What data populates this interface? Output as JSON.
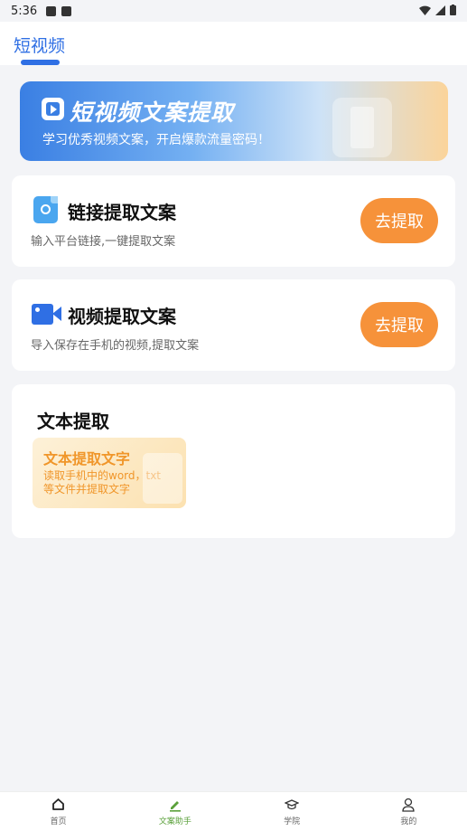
{
  "status_bar": {
    "time": "5:36"
  },
  "header": {
    "title": "短视频"
  },
  "banner": {
    "title": "短视频文案提取",
    "subtitle": "学习优秀视频文案，开启爆款流量密码！"
  },
  "cards": [
    {
      "title": "链接提取文案",
      "subtitle": "输入平台链接,一键提取文案",
      "button": "去提取",
      "icon": "link-icon"
    },
    {
      "title": "视频提取文案",
      "subtitle": "导入保存在手机的视频,提取文案",
      "button": "去提取",
      "icon": "video-camera-icon"
    }
  ],
  "text_section": {
    "title": "文本提取",
    "tile": {
      "title": "文本提取文字",
      "subtitle": "读取手机中的word，txt等文件并提取文字"
    }
  },
  "bottom_nav": [
    {
      "label": "首页",
      "icon": "home-icon"
    },
    {
      "label": "文案助手",
      "icon": "pen-icon",
      "active": true
    },
    {
      "label": "学院",
      "icon": "graduation-cap-icon"
    },
    {
      "label": "我的",
      "icon": "user-icon"
    }
  ],
  "colors": {
    "accent": "#2f6fe4",
    "button": "#f6923a",
    "active_nav": "#5aa03a"
  }
}
